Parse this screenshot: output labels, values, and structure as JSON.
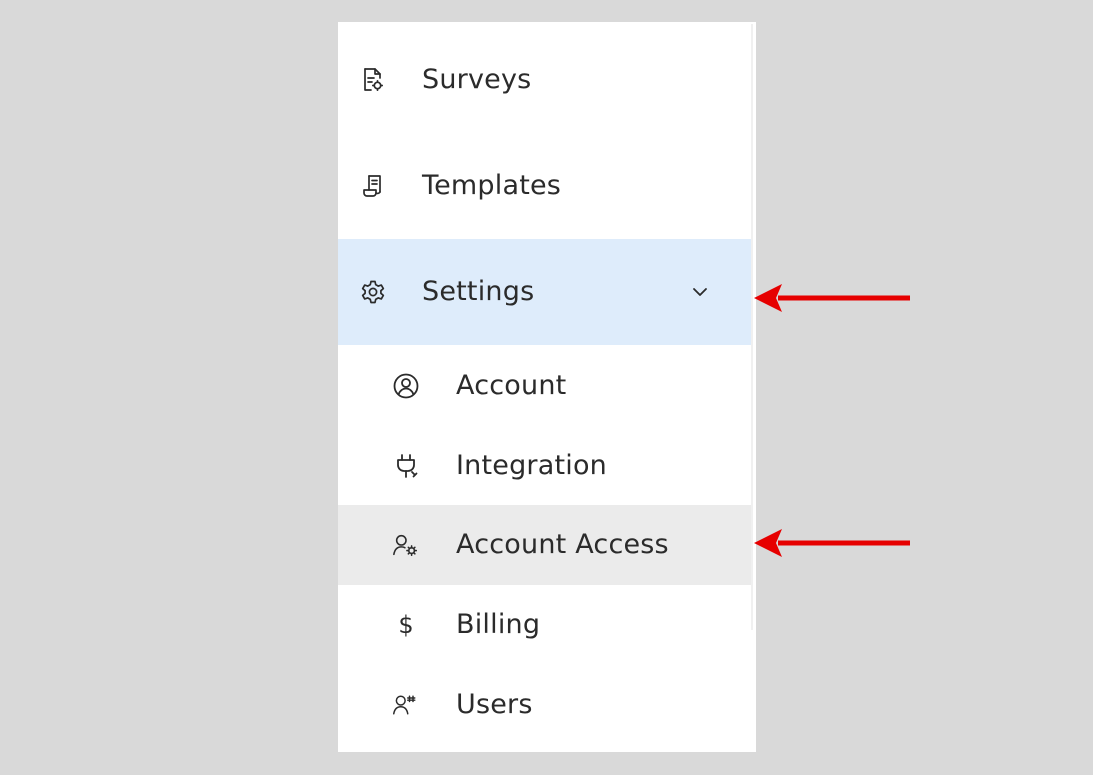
{
  "nav": {
    "items": [
      {
        "label": "Surveys",
        "icon": "survey-document-icon"
      },
      {
        "label": "Templates",
        "icon": "template-document-icon"
      },
      {
        "label": "Settings",
        "icon": "gear-icon",
        "expanded": true
      }
    ],
    "settings_sub": [
      {
        "label": "Account",
        "icon": "account-circle-icon"
      },
      {
        "label": "Integration",
        "icon": "plug-icon"
      },
      {
        "label": "Account Access",
        "icon": "user-settings-icon",
        "highlighted": true
      },
      {
        "label": "Billing",
        "icon": "dollar-icon",
        "symbol": "$"
      },
      {
        "label": "Users",
        "icon": "users-icon"
      }
    ]
  },
  "colors": {
    "background": "#d9d9d9",
    "active_parent_bg": "#deecfb",
    "highlight_row_bg": "#ebebeb",
    "annotation_arrow": "#e60000"
  }
}
